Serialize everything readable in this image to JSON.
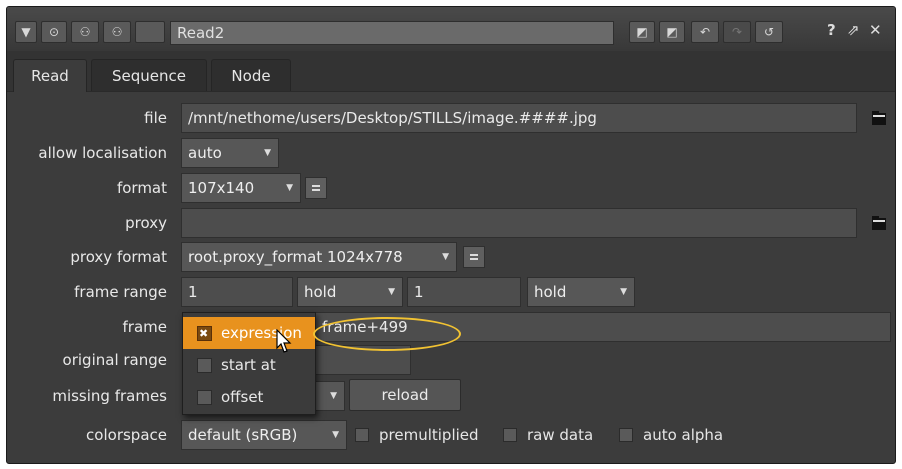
{
  "node_name": "Read2",
  "tabs": [
    {
      "label": "Read",
      "active": true
    },
    {
      "label": "Sequence",
      "active": false
    },
    {
      "label": "Node",
      "active": false
    }
  ],
  "title_icons": [
    "collapse-triangle-icon",
    "node-settings-icon",
    "input-icon",
    "output-icon"
  ],
  "title_right": {
    "help": "?",
    "float": "⇗",
    "close": "✕"
  },
  "file": {
    "label": "file",
    "value": "/mnt/nethome/users/Desktop/STILLS/image.####.jpg"
  },
  "allow_localisation": {
    "label": "allow localisation",
    "value": "auto"
  },
  "format": {
    "label": "format",
    "value": "107x140"
  },
  "proxy": {
    "label": "proxy",
    "value": ""
  },
  "proxy_format": {
    "label": "proxy format",
    "value": "root.proxy_format 1024x778"
  },
  "frame_range": {
    "label": "frame range",
    "first": "1",
    "before": "hold",
    "last": "1",
    "after": "hold"
  },
  "frame": {
    "label": "frame",
    "value": "frame+499"
  },
  "frame_menu": [
    {
      "label": "expression",
      "selected": true
    },
    {
      "label": "start at",
      "selected": false
    },
    {
      "label": "offset",
      "selected": false
    }
  ],
  "original_range": {
    "label": "original range"
  },
  "missing_frames": {
    "label": "missing frames",
    "button": "reload"
  },
  "colorspace": {
    "label": "colorspace",
    "value": "default (sRGB)"
  },
  "checkboxes": {
    "premultiplied": "premultiplied",
    "raw_data": "raw data",
    "auto_alpha": "auto alpha"
  },
  "colors": {
    "accent": "#e8921e",
    "highlight": "#f1c232",
    "panel": "#3c3c3c"
  }
}
